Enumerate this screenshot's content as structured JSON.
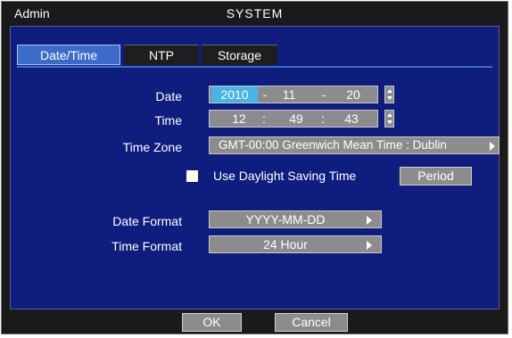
{
  "window": {
    "user": "Admin",
    "title": "SYSTEM"
  },
  "tabs": [
    {
      "label": "Date/Time",
      "active": true
    },
    {
      "label": "NTP",
      "active": false
    },
    {
      "label": "Storage",
      "active": false
    }
  ],
  "form": {
    "date": {
      "label": "Date",
      "year": "2010",
      "month": "11",
      "day": "20",
      "separator": "-"
    },
    "time": {
      "label": "Time",
      "hour": "12",
      "minute": "49",
      "second": "43",
      "separator": ":"
    },
    "time_zone": {
      "label": "Time Zone",
      "value": "GMT-00:00 Greenwich Mean Time : Dublin"
    },
    "dst": {
      "label": "Use Daylight Saving Time",
      "checked": false,
      "period_label": "Period"
    },
    "date_format": {
      "label": "Date Format",
      "value": "YYYY-MM-DD"
    },
    "time_format": {
      "label": "Time Format",
      "value": "24 Hour"
    }
  },
  "footer": {
    "ok_label": "OK",
    "cancel_label": "Cancel"
  },
  "colors": {
    "panel": "#0f1e7e",
    "active_tab": "#3b6cc9",
    "field": "#8c8c8c",
    "selection": "#49b5e6",
    "frame": "#1a1a1a"
  },
  "icons": [
    "spin-up-icon",
    "spin-down-icon",
    "dropdown-arrow-icon",
    "checkbox-icon"
  ]
}
